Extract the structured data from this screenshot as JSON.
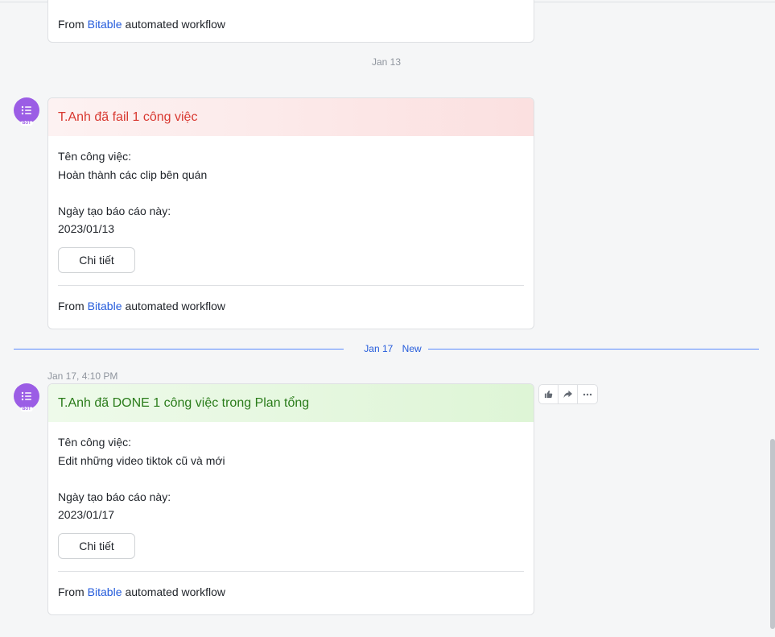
{
  "feed": {
    "prev_card": {
      "footer_prefix": "From",
      "footer_link": "Bitable",
      "footer_suffix": "automated workflow"
    },
    "date_jan13": "Jan 13",
    "new_separator": {
      "date": "Jan 17",
      "label": "New"
    },
    "cards": [
      {
        "header": "T.Anh đã fail 1 công việc",
        "header_color": "#d83931",
        "task_label": "Tên công việc:",
        "task_value": "Hoàn thành các clip bên quán",
        "date_label": "Ngày tạo báo cáo này:",
        "date_value": "2023/01/13",
        "button": "Chi tiết",
        "footer_prefix": "From",
        "footer_link": "Bitable",
        "footer_suffix": "automated workflow"
      },
      {
        "timestamp": "Jan 17, 4:10 PM",
        "header": "T.Anh đã DONE 1 công việc trong Plan tổng",
        "header_color": "#2a7c1a",
        "task_label": "Tên công việc:",
        "task_value": "Edit những video tiktok cũ và mới",
        "date_label": "Ngày tạo báo cáo này:",
        "date_value": "2023/01/17",
        "button": "Chi tiết",
        "footer_prefix": "From",
        "footer_link": "Bitable",
        "footer_suffix": "automated workflow"
      }
    ],
    "avatar": {
      "icon": "bitable-bot-icon",
      "tag": "BOT",
      "color": "#9b5de5"
    },
    "message_actions": [
      {
        "icon": "thumbs-up-icon"
      },
      {
        "icon": "forward-icon"
      },
      {
        "icon": "more-icon"
      }
    ]
  }
}
